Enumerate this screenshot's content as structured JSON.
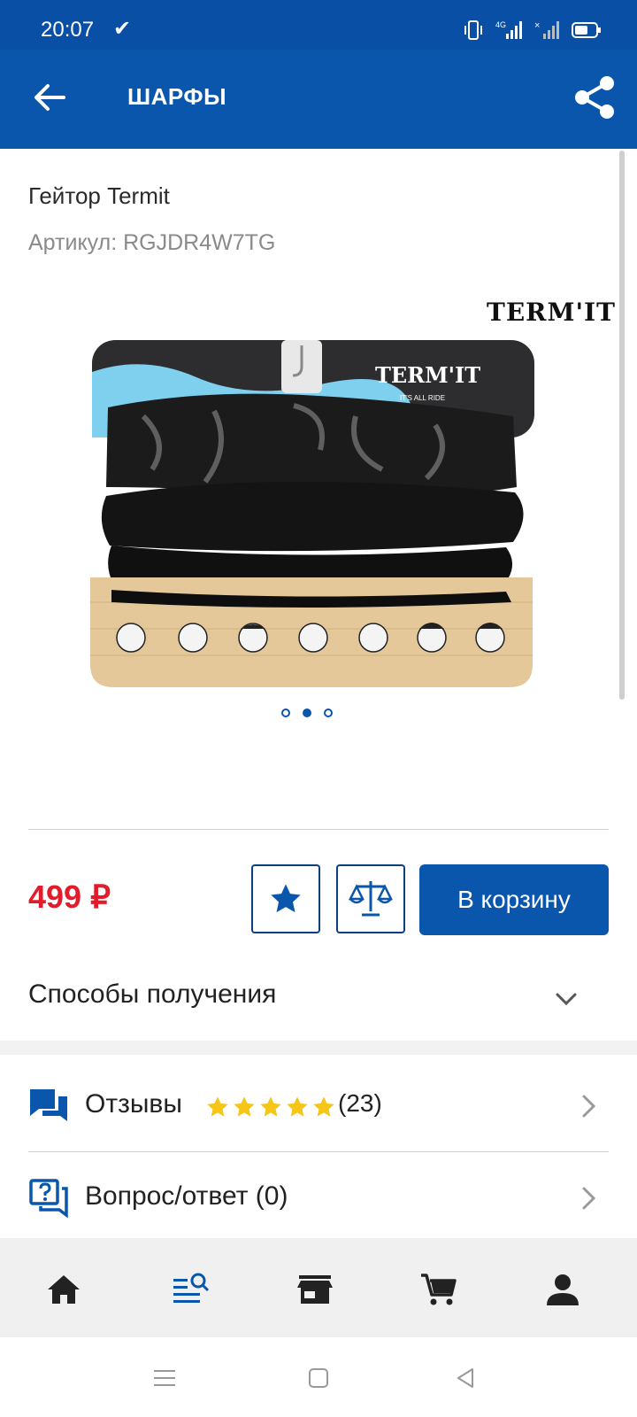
{
  "status_bar": {
    "time": "20:07"
  },
  "app_bar": {
    "title": "ШАРФЫ"
  },
  "product": {
    "name": "Гейтор Termit",
    "sku": "Артикул: RGJDR4W7TG",
    "brand": "TERM'IT",
    "package_brand": "TERM'IT",
    "package_tagline": "IT'S ALL RIDE",
    "image_count": 3,
    "active_image": 2,
    "price": "499 ₽"
  },
  "actions": {
    "add_to_cart": "В корзину"
  },
  "delivery": {
    "label": "Способы получения"
  },
  "reviews": {
    "label": "Отзывы",
    "rating": 5,
    "count": "(23)"
  },
  "qa": {
    "label": "Вопрос/ответ (0)"
  },
  "colors": {
    "primary": "#0a56ac",
    "price": "#e21c2b",
    "star": "#f5c518"
  },
  "bottom_nav": [
    "home-icon",
    "catalog-search-icon",
    "store-icon",
    "cart-icon",
    "profile-icon"
  ]
}
